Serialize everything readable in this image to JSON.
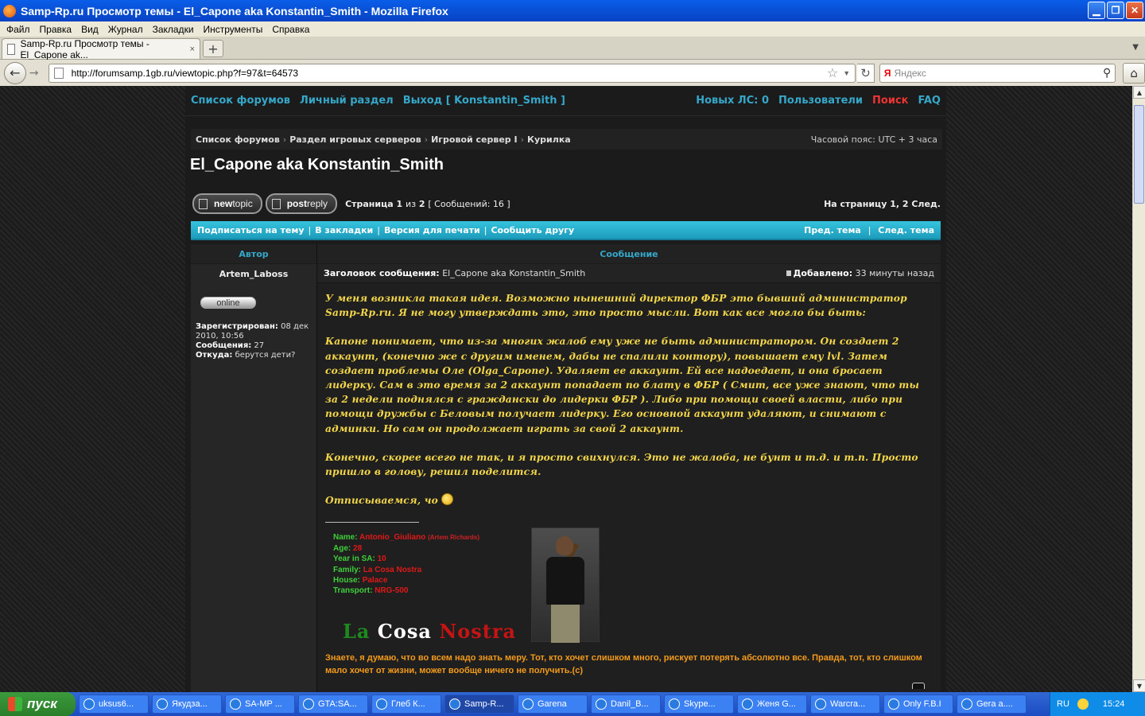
{
  "window": {
    "title": "Samp-Rp.ru Просмотр темы - El_Capone aka Konstantin_Smith - Mozilla Firefox",
    "min_label": "▁",
    "restore_label": "❐",
    "close_label": "✕"
  },
  "menu": [
    "Файл",
    "Правка",
    "Вид",
    "Журнал",
    "Закладки",
    "Инструменты",
    "Справка"
  ],
  "tab": {
    "label": "Samp-Rp.ru Просмотр темы - El_Capone ak...",
    "close": "×",
    "new": "+"
  },
  "nav": {
    "url": "http://forumsamp.1gb.ru/viewtopic.php?f=97&t=64573",
    "search_placeholder": "Яндекс",
    "search_engine": "Я",
    "back": "←",
    "forward": "→",
    "reload": "↻",
    "home": "⌂",
    "star": "☆",
    "magnifier": "⚲"
  },
  "forum": {
    "topnav_left": [
      "Список форумов",
      "Личный раздел",
      "Выход [ Konstantin_Smith ]"
    ],
    "topnav_right": {
      "pm": "Новых ЛС: 0",
      "users": "Пользователи",
      "search": "Поиск",
      "faq": "FAQ"
    },
    "breadcrumbs": [
      "Список форумов",
      "Раздел игровых серверов",
      "Игровой сервер I",
      "Курилка"
    ],
    "timezone": "Часовой пояс: UTC + 3 часа",
    "topic_title": "El_Capone aka Konstantin_Smith",
    "buttons": {
      "new_topic_a": "new",
      "new_topic_b": "topic",
      "post_reply_a": "post",
      "post_reply_b": "reply"
    },
    "page_info": {
      "strana": "Страница",
      "page": "1",
      "iz": "из",
      "total": "2",
      "messages": "[ Сообщений: 16 ]"
    },
    "page_links": "На страницу 1, 2  След.",
    "cyan_links": [
      "Подписаться на тему",
      "В закладки",
      "Версия для печати",
      "Сообщить другу"
    ],
    "cyan_right": [
      "Пред. тема",
      "След. тема"
    ],
    "table_head": {
      "author": "Автор",
      "message": "Сообщение"
    }
  },
  "post": {
    "author": "Artem_Laboss",
    "status": "online",
    "profile": {
      "registered_label": "Зарегистрирован:",
      "registered_value": "08 дек 2010, 10:56",
      "messages_label": "Сообщения:",
      "messages_value": "27",
      "from_label": "Откуда:",
      "from_value": "берутся дети?"
    },
    "subject_label": "Заголовок сообщения:",
    "subject_value": "El_Capone aka Konstantin_Smith",
    "added_label": "Добавлено:",
    "added_value": "33 минуты назад",
    "paragraphs": [
      "У меня возникла такая идея. Возможно нынешний директор ФБР это бывший администратор Samp-Rp.ru. Я не могу утверждать это, это просто мысли. Вот как все могло бы быть:",
      "Капоне понимает, что из-за многих жалоб ему уже не быть администратором. Он создает 2 аккаунт, (конечно же с другим именем, дабы не спалили контору), повышает ему lvl. Затем создает проблемы Оле (Olga_Capone). Удаляет ее аккаунт. Ей все надоедает, и она бросает лидерку. Сам в это время за 2 аккаунт попадает по блату в ФБР ( Смит, все уже знают, что ты за 2 недели поднялся с граждански до лидерки ФБР ). Либо при помощи своей власти, либо при помощи дружбы с Беловым получает лидерку. Его основной аккаунт удаляют, и снимают с админки. Но сам он продолжает играть за свой 2 аккаунт.",
      "Конечно, скорее всего не так, и я просто свихнулся. Это не жалоба, не бунт и т.д. и т.п. Просто пришло в голову, решил поделится."
    ],
    "last_line": "Отписываемся, чо",
    "signature": {
      "fields": [
        {
          "k": "Name:",
          "v": "Antonio_Giuliano",
          "extra": "(Artem Richards)"
        },
        {
          "k": "Age:",
          "v": "28",
          "extra": ""
        },
        {
          "k": "Year in SA:",
          "v": "10",
          "extra": ""
        },
        {
          "k": "Family:",
          "v": "La Cosa Nostra",
          "extra": ""
        },
        {
          "k": "House:",
          "v": "Palace",
          "extra": ""
        },
        {
          "k": "Transport:",
          "v": "NRG-500",
          "extra": ""
        }
      ],
      "logo_la": "La",
      "logo_cosa": "Cosa",
      "logo_nostra": "Nostra",
      "quote": "Знаете, я думаю, что во всем надо знать меру. Тот, кто хочет слишком много, рискует потерять абсолютно все. Правда, тот, кто слишком мало хочет от жизни, может вообще ничего не получить.(с)"
    }
  },
  "taskbar": {
    "start": "пуск",
    "tasks": [
      "uksus6...",
      "Якудза...",
      "SA-MP ...",
      "GTA:SA...",
      "Глеб К...",
      "Samp-R...",
      "Garena",
      "Danil_B...",
      "Skype...",
      "Женя G...",
      "Warcra...",
      "Only F.B.I",
      "Gera a...."
    ],
    "lang": "RU",
    "clock": "15:24"
  }
}
